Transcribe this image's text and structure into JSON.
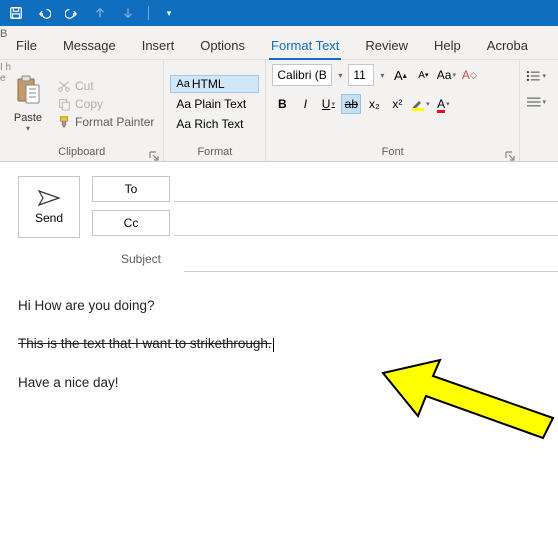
{
  "titlebar": {
    "icons": [
      "save",
      "undo",
      "redo",
      "up",
      "down"
    ]
  },
  "tabs": {
    "items": [
      "File",
      "Message",
      "Insert",
      "Options",
      "Format Text",
      "Review",
      "Help",
      "Acroba"
    ],
    "active_index": 4
  },
  "ribbon": {
    "clipboard": {
      "label": "Clipboard",
      "paste": "Paste",
      "cut": "Cut",
      "copy": "Copy",
      "format_painter": "Format Painter"
    },
    "format": {
      "label": "Format",
      "html": "HTML",
      "plain": "Aa Plain Text",
      "rich": "Aa Rich Text"
    },
    "font": {
      "label": "Font",
      "name": "Calibri (B",
      "size": "11",
      "grow": "A",
      "shrink": "A",
      "case": "Aa",
      "clear": "A",
      "bold": "B",
      "italic": "I",
      "underline": "U",
      "strike": "ab",
      "sub": "x₂",
      "sup": "x²"
    }
  },
  "compose": {
    "send": "Send",
    "to": "To",
    "cc": "Cc",
    "subject": "Subject"
  },
  "body": {
    "line1": "Hi How are you doing?",
    "line2": "This is the text that I want to strikethrough.",
    "line3": "Have a nice day!"
  }
}
